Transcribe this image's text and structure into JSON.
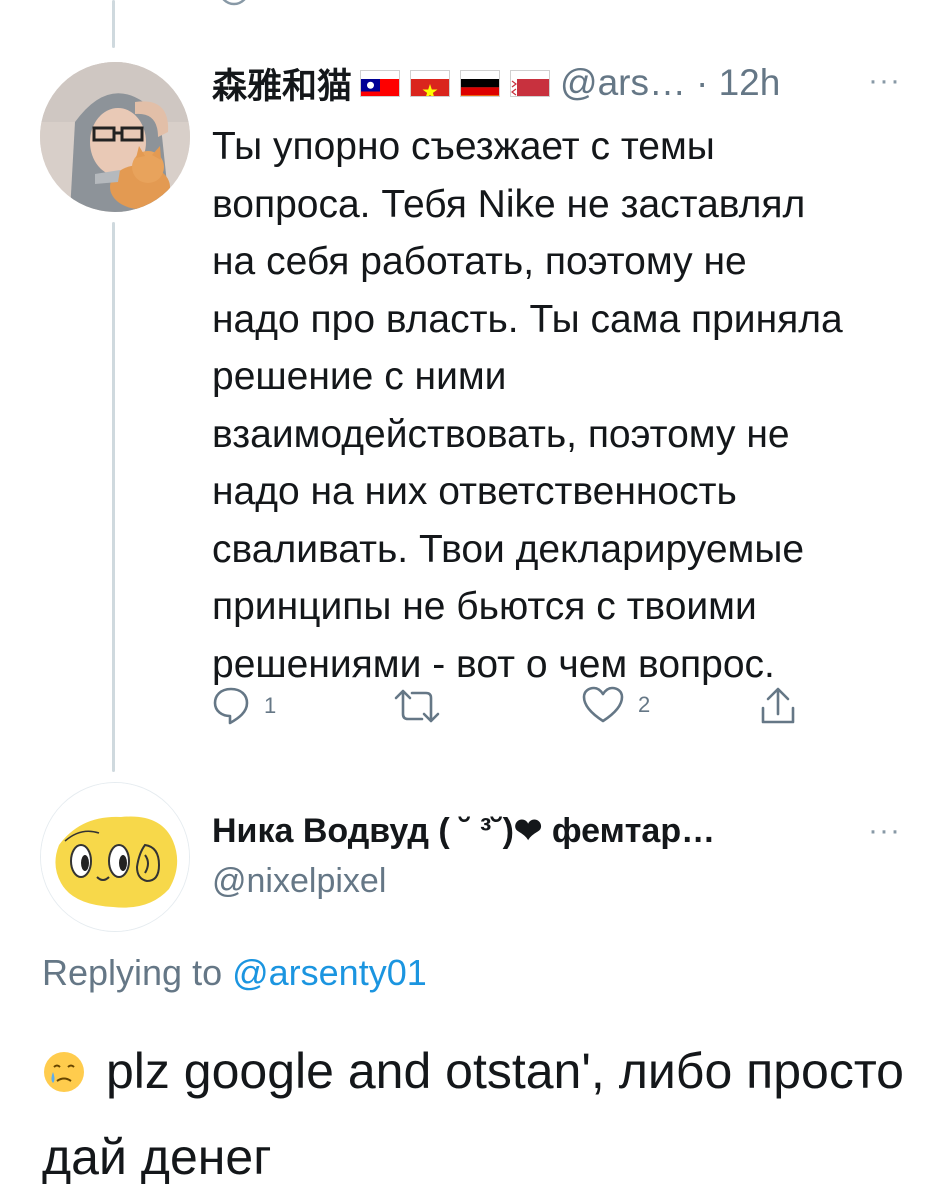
{
  "colors": {
    "link": "#1b95e0",
    "muted": "#657786",
    "thread_line": "#cfd9de"
  },
  "tweet": {
    "display_name": "森雅和猫",
    "flags": [
      "taiwan-flag",
      "vietnam-flag",
      "germany-flag",
      "belarus-flag"
    ],
    "handle": "@ars…",
    "dot_time": "· 12h",
    "text": "Ты упорно съезжает с темы\nвопроса. Тебя Nike не заставлял\nна себя работать, поэтому не\nнадо про власть. Ты сама приняла\nрешение с ними\nвзаимодействовать, поэтому не\nнадо на них ответственность\nсваливать. Твои декларируемые\nпринципы не бьются с твоими\nрешениями - вот о чем вопрос.",
    "actions": {
      "reply_count": "1",
      "retweet_count": "",
      "like_count": "2"
    },
    "icons": [
      "reply-icon",
      "retweet-icon",
      "like-icon",
      "share-icon",
      "more-icon"
    ]
  },
  "reply": {
    "display_name": "Ника Водвуд ( ˘ ³˘)❤ фемтар…",
    "handle": "@nixelpixel",
    "replying_prefix": "Replying to ",
    "replying_handle": "@arsenty01",
    "text": "plz google and otstan', либо просто дай денег",
    "icons": [
      "crying-face-icon",
      "more-icon"
    ]
  }
}
